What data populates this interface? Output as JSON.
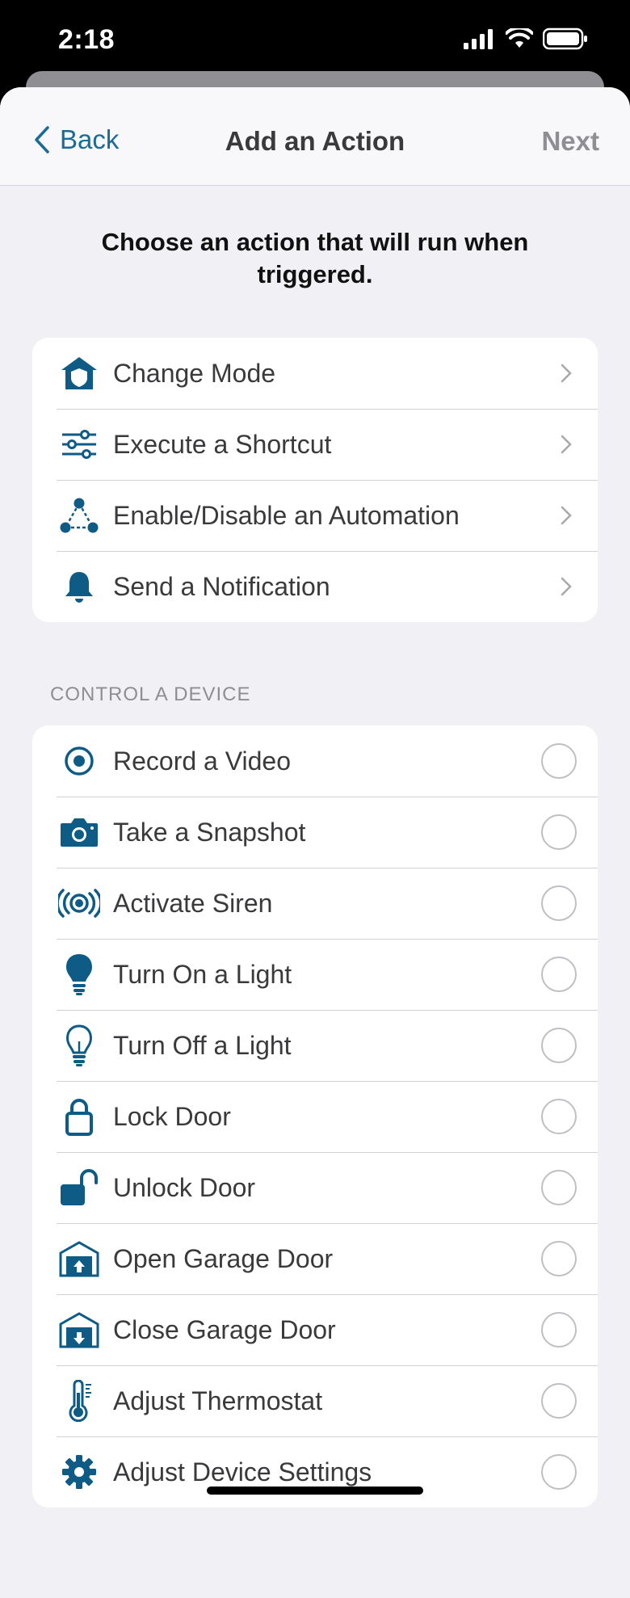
{
  "status": {
    "time": "2:18"
  },
  "nav": {
    "back_label": "Back",
    "title": "Add an Action",
    "next_label": "Next"
  },
  "instruction": "Choose an action that will run when triggered.",
  "actions": [
    {
      "label": "Change Mode",
      "icon": "home-shield-icon"
    },
    {
      "label": "Execute a Shortcut",
      "icon": "sliders-icon"
    },
    {
      "label": "Enable/Disable an Automation",
      "icon": "automation-nodes-icon"
    },
    {
      "label": "Send a Notification",
      "icon": "bell-icon"
    }
  ],
  "device_section": {
    "header": "CONTROL A DEVICE",
    "items": [
      {
        "label": "Record a Video",
        "icon": "record-icon"
      },
      {
        "label": "Take a Snapshot",
        "icon": "camera-icon"
      },
      {
        "label": "Activate Siren",
        "icon": "siren-icon"
      },
      {
        "label": "Turn On a Light",
        "icon": "bulb-filled-icon"
      },
      {
        "label": "Turn Off a Light",
        "icon": "bulb-outline-icon"
      },
      {
        "label": "Lock Door",
        "icon": "lock-icon"
      },
      {
        "label": "Unlock Door",
        "icon": "unlock-icon"
      },
      {
        "label": "Open Garage Door",
        "icon": "garage-open-icon"
      },
      {
        "label": "Close Garage Door",
        "icon": "garage-close-icon"
      },
      {
        "label": "Adjust Thermostat",
        "icon": "thermometer-icon"
      },
      {
        "label": "Adjust Device Settings",
        "icon": "gear-icon"
      }
    ]
  },
  "colors": {
    "accent": "#1b6b95",
    "icon": "#0e5c86",
    "background": "#f0f0f5"
  }
}
